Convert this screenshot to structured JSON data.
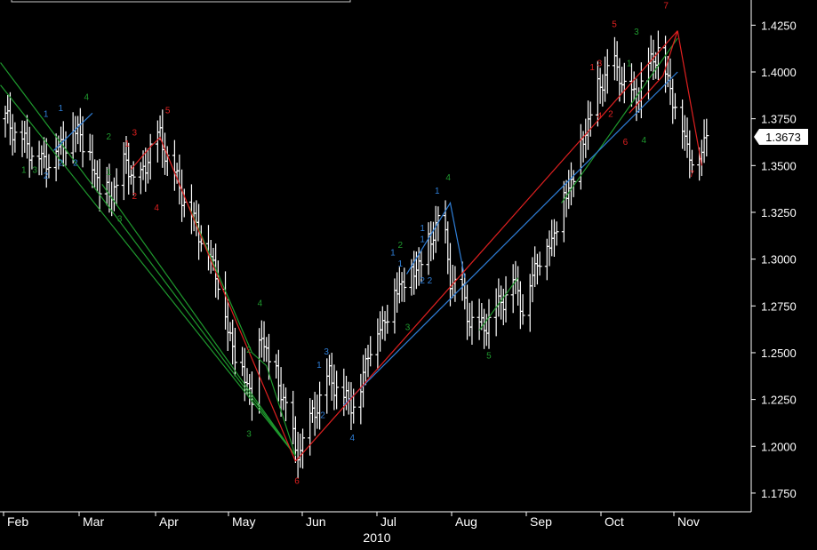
{
  "chart_data": {
    "type": "bar",
    "subtype": "ohlc",
    "instrument_hint": "EUR/USD",
    "x_axis": {
      "year_label": "2010",
      "month_ticks": [
        "Feb",
        "Mar",
        "Apr",
        "May",
        "Jun",
        "Jul",
        "Aug",
        "Sep",
        "Oct",
        "Nov"
      ],
      "month_start_day": [
        0,
        28,
        59,
        89,
        120,
        150,
        181,
        212,
        242,
        273
      ]
    },
    "y_axis": {
      "ylim": [
        1.165,
        1.4375
      ],
      "tick_labels": [
        "1.1750",
        "1.2000",
        "1.2250",
        "1.2500",
        "1.2750",
        "1.3000",
        "1.3250",
        "1.3500",
        "1.3750",
        "1.4000",
        "1.4250"
      ],
      "tick_values": [
        1.175,
        1.2,
        1.225,
        1.25,
        1.275,
        1.3,
        1.325,
        1.35,
        1.375,
        1.4,
        1.425
      ]
    },
    "last_price": "1.3673",
    "price_path": [
      [
        0,
        1.375
      ],
      [
        8,
        1.362
      ],
      [
        16,
        1.352
      ],
      [
        24,
        1.362
      ],
      [
        30,
        1.37
      ],
      [
        36,
        1.35
      ],
      [
        40,
        1.335
      ],
      [
        44,
        1.335
      ],
      [
        50,
        1.352
      ],
      [
        55,
        1.337
      ],
      [
        60,
        1.36
      ],
      [
        64,
        1.365
      ],
      [
        70,
        1.345
      ],
      [
        76,
        1.326
      ],
      [
        82,
        1.31
      ],
      [
        88,
        1.29
      ],
      [
        92,
        1.262
      ],
      [
        98,
        1.24
      ],
      [
        102,
        1.227
      ],
      [
        106,
        1.26
      ],
      [
        110,
        1.243
      ],
      [
        116,
        1.223
      ],
      [
        120,
        1.196
      ],
      [
        124,
        1.205
      ],
      [
        128,
        1.22
      ],
      [
        134,
        1.238
      ],
      [
        140,
        1.226
      ],
      [
        146,
        1.223
      ],
      [
        150,
        1.252
      ],
      [
        156,
        1.265
      ],
      [
        160,
        1.28
      ],
      [
        165,
        1.29
      ],
      [
        168,
        1.292
      ],
      [
        172,
        1.3
      ],
      [
        176,
        1.31
      ],
      [
        180,
        1.328
      ],
      [
        184,
        1.29
      ],
      [
        188,
        1.285
      ],
      [
        192,
        1.268
      ],
      [
        196,
        1.263
      ],
      [
        200,
        1.268
      ],
      [
        206,
        1.28
      ],
      [
        210,
        1.29
      ],
      [
        214,
        1.274
      ],
      [
        220,
        1.3
      ],
      [
        226,
        1.31
      ],
      [
        230,
        1.33
      ],
      [
        236,
        1.348
      ],
      [
        240,
        1.37
      ],
      [
        245,
        1.39
      ],
      [
        250,
        1.405
      ],
      [
        254,
        1.4
      ],
      [
        258,
        1.385
      ],
      [
        262,
        1.39
      ],
      [
        266,
        1.403
      ],
      [
        270,
        1.413
      ],
      [
        274,
        1.395
      ],
      [
        278,
        1.38
      ],
      [
        282,
        1.36
      ],
      [
        286,
        1.35
      ],
      [
        290,
        1.368
      ]
    ],
    "wave_lines": [
      {
        "color": "#1f9a2e",
        "points": [
          [
            -2,
            1.405
          ],
          [
            120,
            1.195
          ]
        ]
      },
      {
        "color": "#1f9a2e",
        "points": [
          [
            -2,
            1.393
          ],
          [
            120,
            1.195
          ]
        ]
      },
      {
        "color": "#1f9a2e",
        "points": [
          [
            40,
            1.34
          ],
          [
            120,
            1.195
          ]
        ]
      },
      {
        "color": "#1f9a2e",
        "points": [
          [
            76,
            1.328
          ],
          [
            102,
            1.25
          ],
          [
            108,
            1.243
          ],
          [
            120,
            1.195
          ]
        ]
      },
      {
        "color": "#1f9a2e",
        "points": [
          [
            196,
            1.262
          ],
          [
            212,
            1.29
          ]
        ]
      },
      {
        "color": "#1f9a2e",
        "points": [
          [
            230,
            1.33
          ],
          [
            278,
            1.418
          ]
        ]
      },
      {
        "color": "#2f7fd8",
        "points": [
          [
            20,
            1.358
          ],
          [
            36,
            1.378
          ]
        ]
      },
      {
        "color": "#2f7fd8",
        "points": [
          [
            140,
            1.222
          ],
          [
            278,
            1.4
          ]
        ]
      },
      {
        "color": "#2f7fd8",
        "points": [
          [
            166,
            1.292
          ],
          [
            184,
            1.33
          ],
          [
            190,
            1.29
          ]
        ]
      },
      {
        "color": "#e02020",
        "points": [
          [
            52,
            1.348
          ],
          [
            60,
            1.36
          ],
          [
            64,
            1.365
          ],
          [
            96,
            1.265
          ],
          [
            120,
            1.192
          ]
        ]
      },
      {
        "color": "#e02020",
        "points": [
          [
            120,
            1.192
          ],
          [
            278,
            1.422
          ]
        ]
      },
      {
        "color": "#e02020",
        "points": [
          [
            258,
            1.378
          ],
          [
            272,
            1.398
          ],
          [
            278,
            1.422
          ],
          [
            288,
            1.35
          ]
        ]
      }
    ],
    "wave_labels": [
      {
        "text": "1",
        "color": "#1f9a2e",
        "x": 5,
        "y": 1.346
      },
      {
        "text": "3",
        "color": "#1f9a2e",
        "x": 8,
        "y": 1.346
      },
      {
        "text": "2",
        "color": "#2f7fd8",
        "x": 11,
        "y": 1.343
      },
      {
        "text": "1",
        "color": "#2f7fd8",
        "x": 11,
        "y": 1.376
      },
      {
        "text": "1",
        "color": "#2f7fd8",
        "x": 15,
        "y": 1.379
      },
      {
        "text": "2",
        "color": "#2f7fd8",
        "x": 15,
        "y": 1.35
      },
      {
        "text": "2",
        "color": "#2f7fd8",
        "x": 19,
        "y": 1.35
      },
      {
        "text": "4",
        "color": "#1f9a2e",
        "x": 22,
        "y": 1.385
      },
      {
        "text": "2",
        "color": "#1f9a2e",
        "x": 28,
        "y": 1.364
      },
      {
        "text": "1",
        "color": "#1f9a2e",
        "x": 28,
        "y": 1.345
      },
      {
        "text": "1",
        "color": "#e02020",
        "x": 33,
        "y": 1.36
      },
      {
        "text": "3",
        "color": "#e02020",
        "x": 35,
        "y": 1.366
      },
      {
        "text": "2",
        "color": "#e02020",
        "x": 35,
        "y": 1.332
      },
      {
        "text": "3",
        "color": "#1f9a2e",
        "x": 31,
        "y": 1.32
      },
      {
        "text": "4",
        "color": "#e02020",
        "x": 41,
        "y": 1.326
      },
      {
        "text": "5",
        "color": "#e02020",
        "x": 44,
        "y": 1.378
      },
      {
        "text": "4",
        "color": "#1f9a2e",
        "x": 69,
        "y": 1.275
      },
      {
        "text": "2",
        "color": "#1f9a2e",
        "x": 66,
        "y": 1.25
      },
      {
        "text": "3",
        "color": "#1f9a2e",
        "x": 66,
        "y": 1.205
      },
      {
        "text": "6",
        "color": "#e02020",
        "x": 79,
        "y": 1.18
      },
      {
        "text": "1",
        "color": "#2f7fd8",
        "x": 85,
        "y": 1.242
      },
      {
        "text": "3",
        "color": "#2f7fd8",
        "x": 87,
        "y": 1.249
      },
      {
        "text": "2",
        "color": "#2f7fd8",
        "x": 86,
        "y": 1.215
      },
      {
        "text": "4",
        "color": "#2f7fd8",
        "x": 94,
        "y": 1.203
      },
      {
        "text": "1",
        "color": "#2f7fd8",
        "x": 105,
        "y": 1.302
      },
      {
        "text": "2",
        "color": "#1f9a2e",
        "x": 107,
        "y": 1.306
      },
      {
        "text": "1",
        "color": "#2f7fd8",
        "x": 107,
        "y": 1.296
      },
      {
        "text": "3",
        "color": "#1f9a2e",
        "x": 109,
        "y": 1.262
      },
      {
        "text": "2",
        "color": "#2f7fd8",
        "x": 113,
        "y": 1.287
      },
      {
        "text": "2",
        "color": "#2f7fd8",
        "x": 115,
        "y": 1.287
      },
      {
        "text": "1",
        "color": "#2f7fd8",
        "x": 113,
        "y": 1.309
      },
      {
        "text": "1",
        "color": "#2f7fd8",
        "x": 113,
        "y": 1.315
      },
      {
        "text": "1",
        "color": "#2f7fd8",
        "x": 117,
        "y": 1.335
      },
      {
        "text": "4",
        "color": "#1f9a2e",
        "x": 120,
        "y": 1.342
      },
      {
        "text": "5",
        "color": "#1f9a2e",
        "x": 131,
        "y": 1.247
      },
      {
        "text": "1",
        "color": "#e02020",
        "x": 159,
        "y": 1.401
      },
      {
        "text": "3",
        "color": "#e02020",
        "x": 161,
        "y": 1.403
      },
      {
        "text": "5",
        "color": "#e02020",
        "x": 165,
        "y": 1.424
      },
      {
        "text": "3",
        "color": "#1f9a2e",
        "x": 171,
        "y": 1.42
      },
      {
        "text": "1",
        "color": "#1f9a2e",
        "x": 169,
        "y": 1.403
      },
      {
        "text": "4",
        "color": "#e02020",
        "x": 161,
        "y": 1.375
      },
      {
        "text": "2",
        "color": "#e02020",
        "x": 164,
        "y": 1.376
      },
      {
        "text": "6",
        "color": "#e02020",
        "x": 168,
        "y": 1.361
      },
      {
        "text": "4",
        "color": "#1f9a2e",
        "x": 173,
        "y": 1.362
      },
      {
        "text": "7",
        "color": "#e02020",
        "x": 179,
        "y": 1.434
      },
      {
        "text": "7",
        "color": "#e02020",
        "x": 186,
        "y": 1.344
      }
    ]
  }
}
